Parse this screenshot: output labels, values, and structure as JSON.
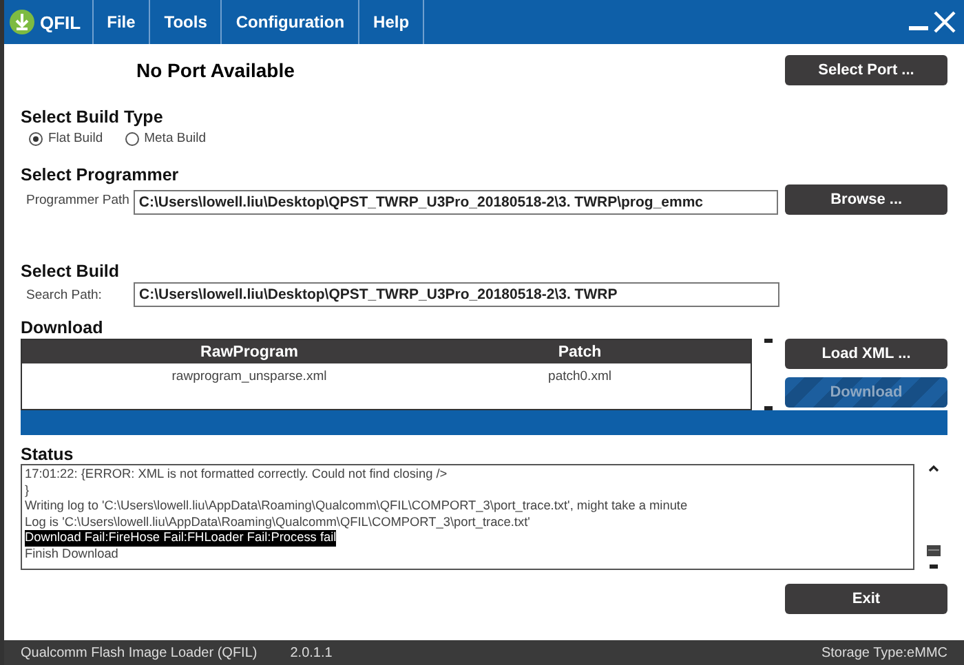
{
  "window": {
    "title": "QFIL"
  },
  "menu": [
    {
      "label": "File"
    },
    {
      "label": "Tools"
    },
    {
      "label": "Configuration"
    },
    {
      "label": "Help"
    }
  ],
  "port": {
    "status": "No Port Available",
    "button": "Select Port ..."
  },
  "build_type": {
    "heading": "Select Build Type",
    "options": [
      {
        "label": "Flat Build",
        "selected": true
      },
      {
        "label": "Meta Build",
        "selected": false
      }
    ]
  },
  "programmer": {
    "heading": "Select Programmer",
    "label": "Programmer Path",
    "value": "C:\\Users\\lowell.liu\\Desktop\\QPST_TWRP_U3Pro_20180518-2\\3. TWRP\\prog_emmc",
    "button": "Browse ..."
  },
  "build": {
    "heading": "Select Build",
    "label": "Search Path:",
    "value": "C:\\Users\\lowell.liu\\Desktop\\QPST_TWRP_U3Pro_20180518-2\\3. TWRP"
  },
  "download": {
    "heading": "Download",
    "table": {
      "columns": [
        "RawProgram",
        "Patch"
      ],
      "rows": [
        [
          "rawprogram_unsparse.xml",
          "patch0.xml"
        ]
      ]
    },
    "buttons": [
      {
        "label": "Load XML ...",
        "disabled": false
      },
      {
        "label": "Download",
        "disabled": true
      }
    ],
    "progress": {
      "level": 1
    }
  },
  "status": {
    "heading": "Status",
    "lines": [
      {
        "text": "17:01:22: {ERROR: XML is not formatted correctly. Could not find closing />",
        "highlighted": false
      },
      {
        "text": "}",
        "highlighted": false
      },
      {
        "text": "Writing log to 'C:\\Users\\lowell.liu\\AppData\\Roaming\\Qualcomm\\QFIL\\COMPORT_3\\port_trace.txt', might take a minute",
        "highlighted": false
      },
      {
        "text": "Log is 'C:\\Users\\lowell.liu\\AppData\\Roaming\\Qualcomm\\QFIL\\COMPORT_3\\port_trace.txt'",
        "highlighted": false
      },
      {
        "text": "Download Fail:FireHose Fail:FHLoader Fail:Process fail",
        "highlighted": true
      },
      {
        "text": "Finish Download",
        "highlighted": false
      }
    ]
  },
  "exit_button": "Exit",
  "status_bar": {
    "app_name": "Qualcomm Flash Image Loader (QFIL)",
    "version": "2.0.1.1",
    "storage": "Storage Type:eMMC"
  }
}
